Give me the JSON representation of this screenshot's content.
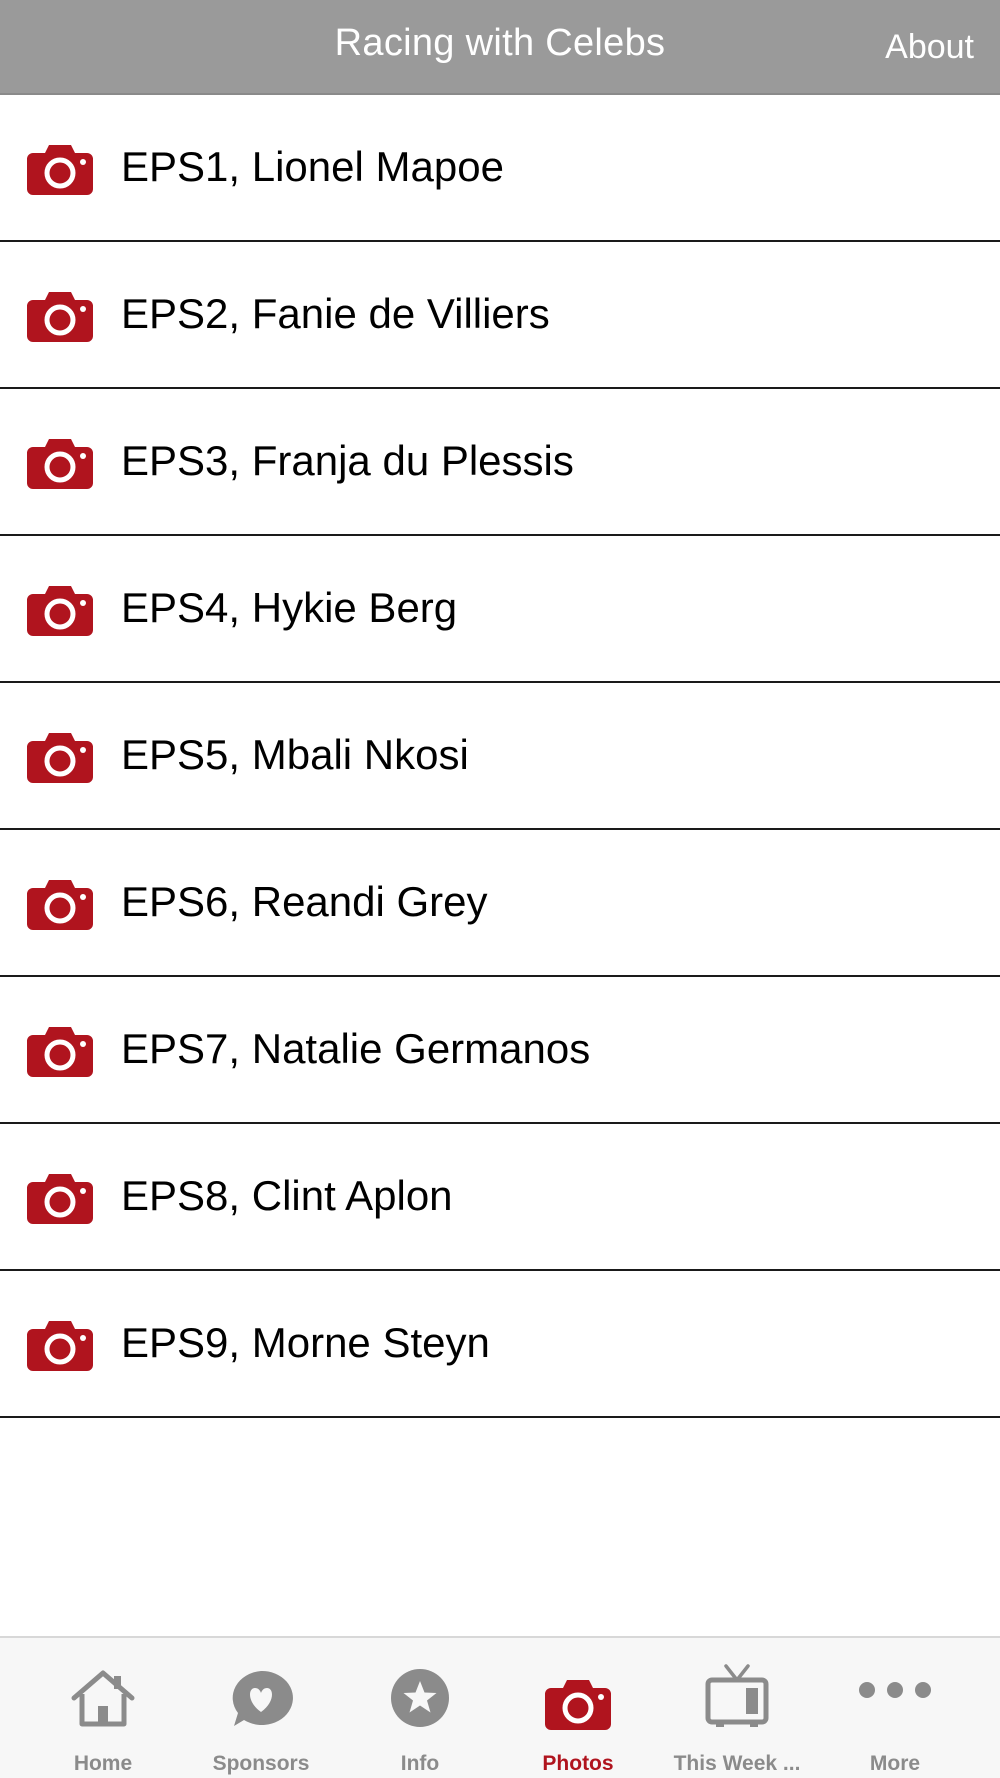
{
  "header": {
    "title": "Racing with Celebs",
    "about_label": "About"
  },
  "colors": {
    "accent": "#b0141e",
    "navbar": "#9a9a9a",
    "tab_inactive": "#8b8b8b"
  },
  "list": {
    "icon": "camera-icon",
    "items": [
      {
        "label": "EPS1, Lionel Mapoe"
      },
      {
        "label": "EPS2, Fanie de Villiers"
      },
      {
        "label": "EPS3, Franja du Plessis"
      },
      {
        "label": "EPS4, Hykie Berg"
      },
      {
        "label": "EPS5, Mbali Nkosi"
      },
      {
        "label": "EPS6, Reandi Grey"
      },
      {
        "label": "EPS7, Natalie Germanos"
      },
      {
        "label": "EPS8, Clint Aplon"
      },
      {
        "label": "EPS9, Morne Steyn"
      }
    ]
  },
  "tabbar": {
    "tabs": [
      {
        "label": "Home",
        "icon": "home-icon",
        "active": false
      },
      {
        "label": "Sponsors",
        "icon": "heart-bubble-icon",
        "active": false
      },
      {
        "label": "Info",
        "icon": "star-icon",
        "active": false
      },
      {
        "label": "Photos",
        "icon": "camera-icon",
        "active": true
      },
      {
        "label": "This Week ...",
        "icon": "tv-icon",
        "active": false
      },
      {
        "label": "More",
        "icon": "more-dots-icon",
        "active": false
      }
    ]
  }
}
